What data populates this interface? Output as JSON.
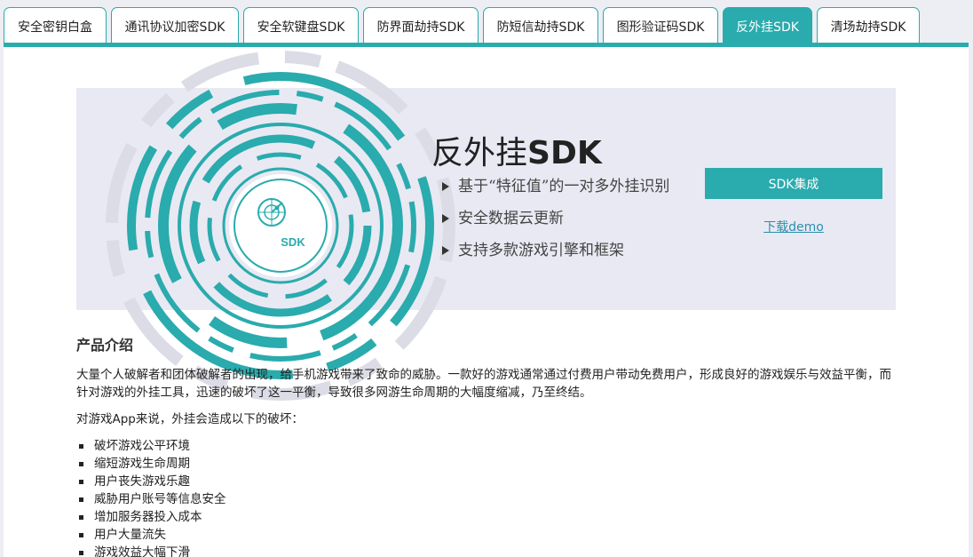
{
  "tabs": [
    {
      "label": "安全密钥白盒",
      "active": false
    },
    {
      "label": "通讯协议加密SDK",
      "active": false
    },
    {
      "label": "安全软键盘SDK",
      "active": false
    },
    {
      "label": "防界面劫持SDK",
      "active": false
    },
    {
      "label": "防短信劫持SDK",
      "active": false
    },
    {
      "label": "图形验证码SDK",
      "active": false
    },
    {
      "label": "反外挂SDK",
      "active": true
    },
    {
      "label": "清场劫持SDK",
      "active": false
    }
  ],
  "banner": {
    "title_prefix": "反外挂",
    "title_bold": "SDK",
    "logo_text": "SDK",
    "features": [
      "基于“特征值”的一对多外挂识别",
      "安全数据云更新",
      "支持多款游戏引擎和框架"
    ],
    "integrate_button": "SDK集成",
    "demo_link": "下载demo"
  },
  "intro": {
    "heading": "产品介绍",
    "paragraph": "大量个人破解者和团体破解者的出现，给手机游戏带来了致命的威胁。一款好的游戏通常通过付费用户带动免费用户，形成良好的游戏娱乐与效益平衡，而针对游戏的外挂工具，迅速的破坏了这一平衡，导致很多网游生命周期的大幅度缩减，乃至终结。",
    "lead": "对游戏App来说，外挂会造成以下的破坏：",
    "items": [
      "破坏游戏公平环境",
      "缩短游戏生命周期",
      "用户丧失游戏乐趣",
      "威胁用户账号等信息安全",
      "增加服务器投入成本",
      "用户大量流失",
      "游戏效益大幅下滑"
    ]
  },
  "colors": {
    "accent": "#2aabad",
    "banner_bg": "#e9e9f3"
  }
}
